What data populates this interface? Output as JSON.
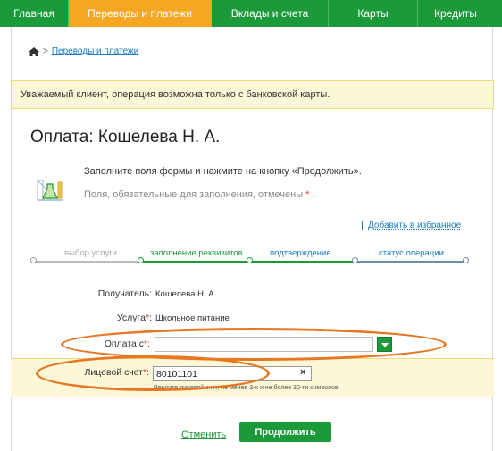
{
  "nav": {
    "tabs": [
      {
        "label": "Главная"
      },
      {
        "label": "Переводы и платежи"
      },
      {
        "label": "Вклады и счета"
      },
      {
        "label": "Карты"
      },
      {
        "label": "Кредиты"
      }
    ]
  },
  "breadcrumb": {
    "link": "Переводы и платежи"
  },
  "notice": "Уважаемый клиент, операция возможна только с банковской карты.",
  "title": "Оплата: Кошелева Н. А.",
  "hint": {
    "line1": "Заполните поля формы и нажмите на кнопку «Продолжить».",
    "line2": "Поля, обязательные для заполнения, отмечены",
    "marker": "* ."
  },
  "favorites": "Добавить в избранное",
  "steps": [
    "выбор услуги",
    "заполнение реквизитов",
    "подтверждение",
    "статус операции"
  ],
  "form": {
    "recipient_label": "Получатель:",
    "recipient_value": "Кошелева Н. А.",
    "service_label": "Услуга",
    "service_value": "Школьное питание",
    "pay_from_label": "Оплата с",
    "pay_from_value": "",
    "account_label": "Лицевой счет",
    "account_value": "80101101",
    "account_hint": "Введите лицевой счет, не менее 3-х и не более 30-ти символов.",
    "required_mark": "*",
    "colon": ":"
  },
  "actions": {
    "cancel": "Отменить",
    "continue": "Продолжить"
  },
  "colors": {
    "brand_green": "#1b9a3a",
    "active_tab": "#f5a623",
    "highlight_oval": "#e87722",
    "notice_bg": "#fdf6d7"
  }
}
